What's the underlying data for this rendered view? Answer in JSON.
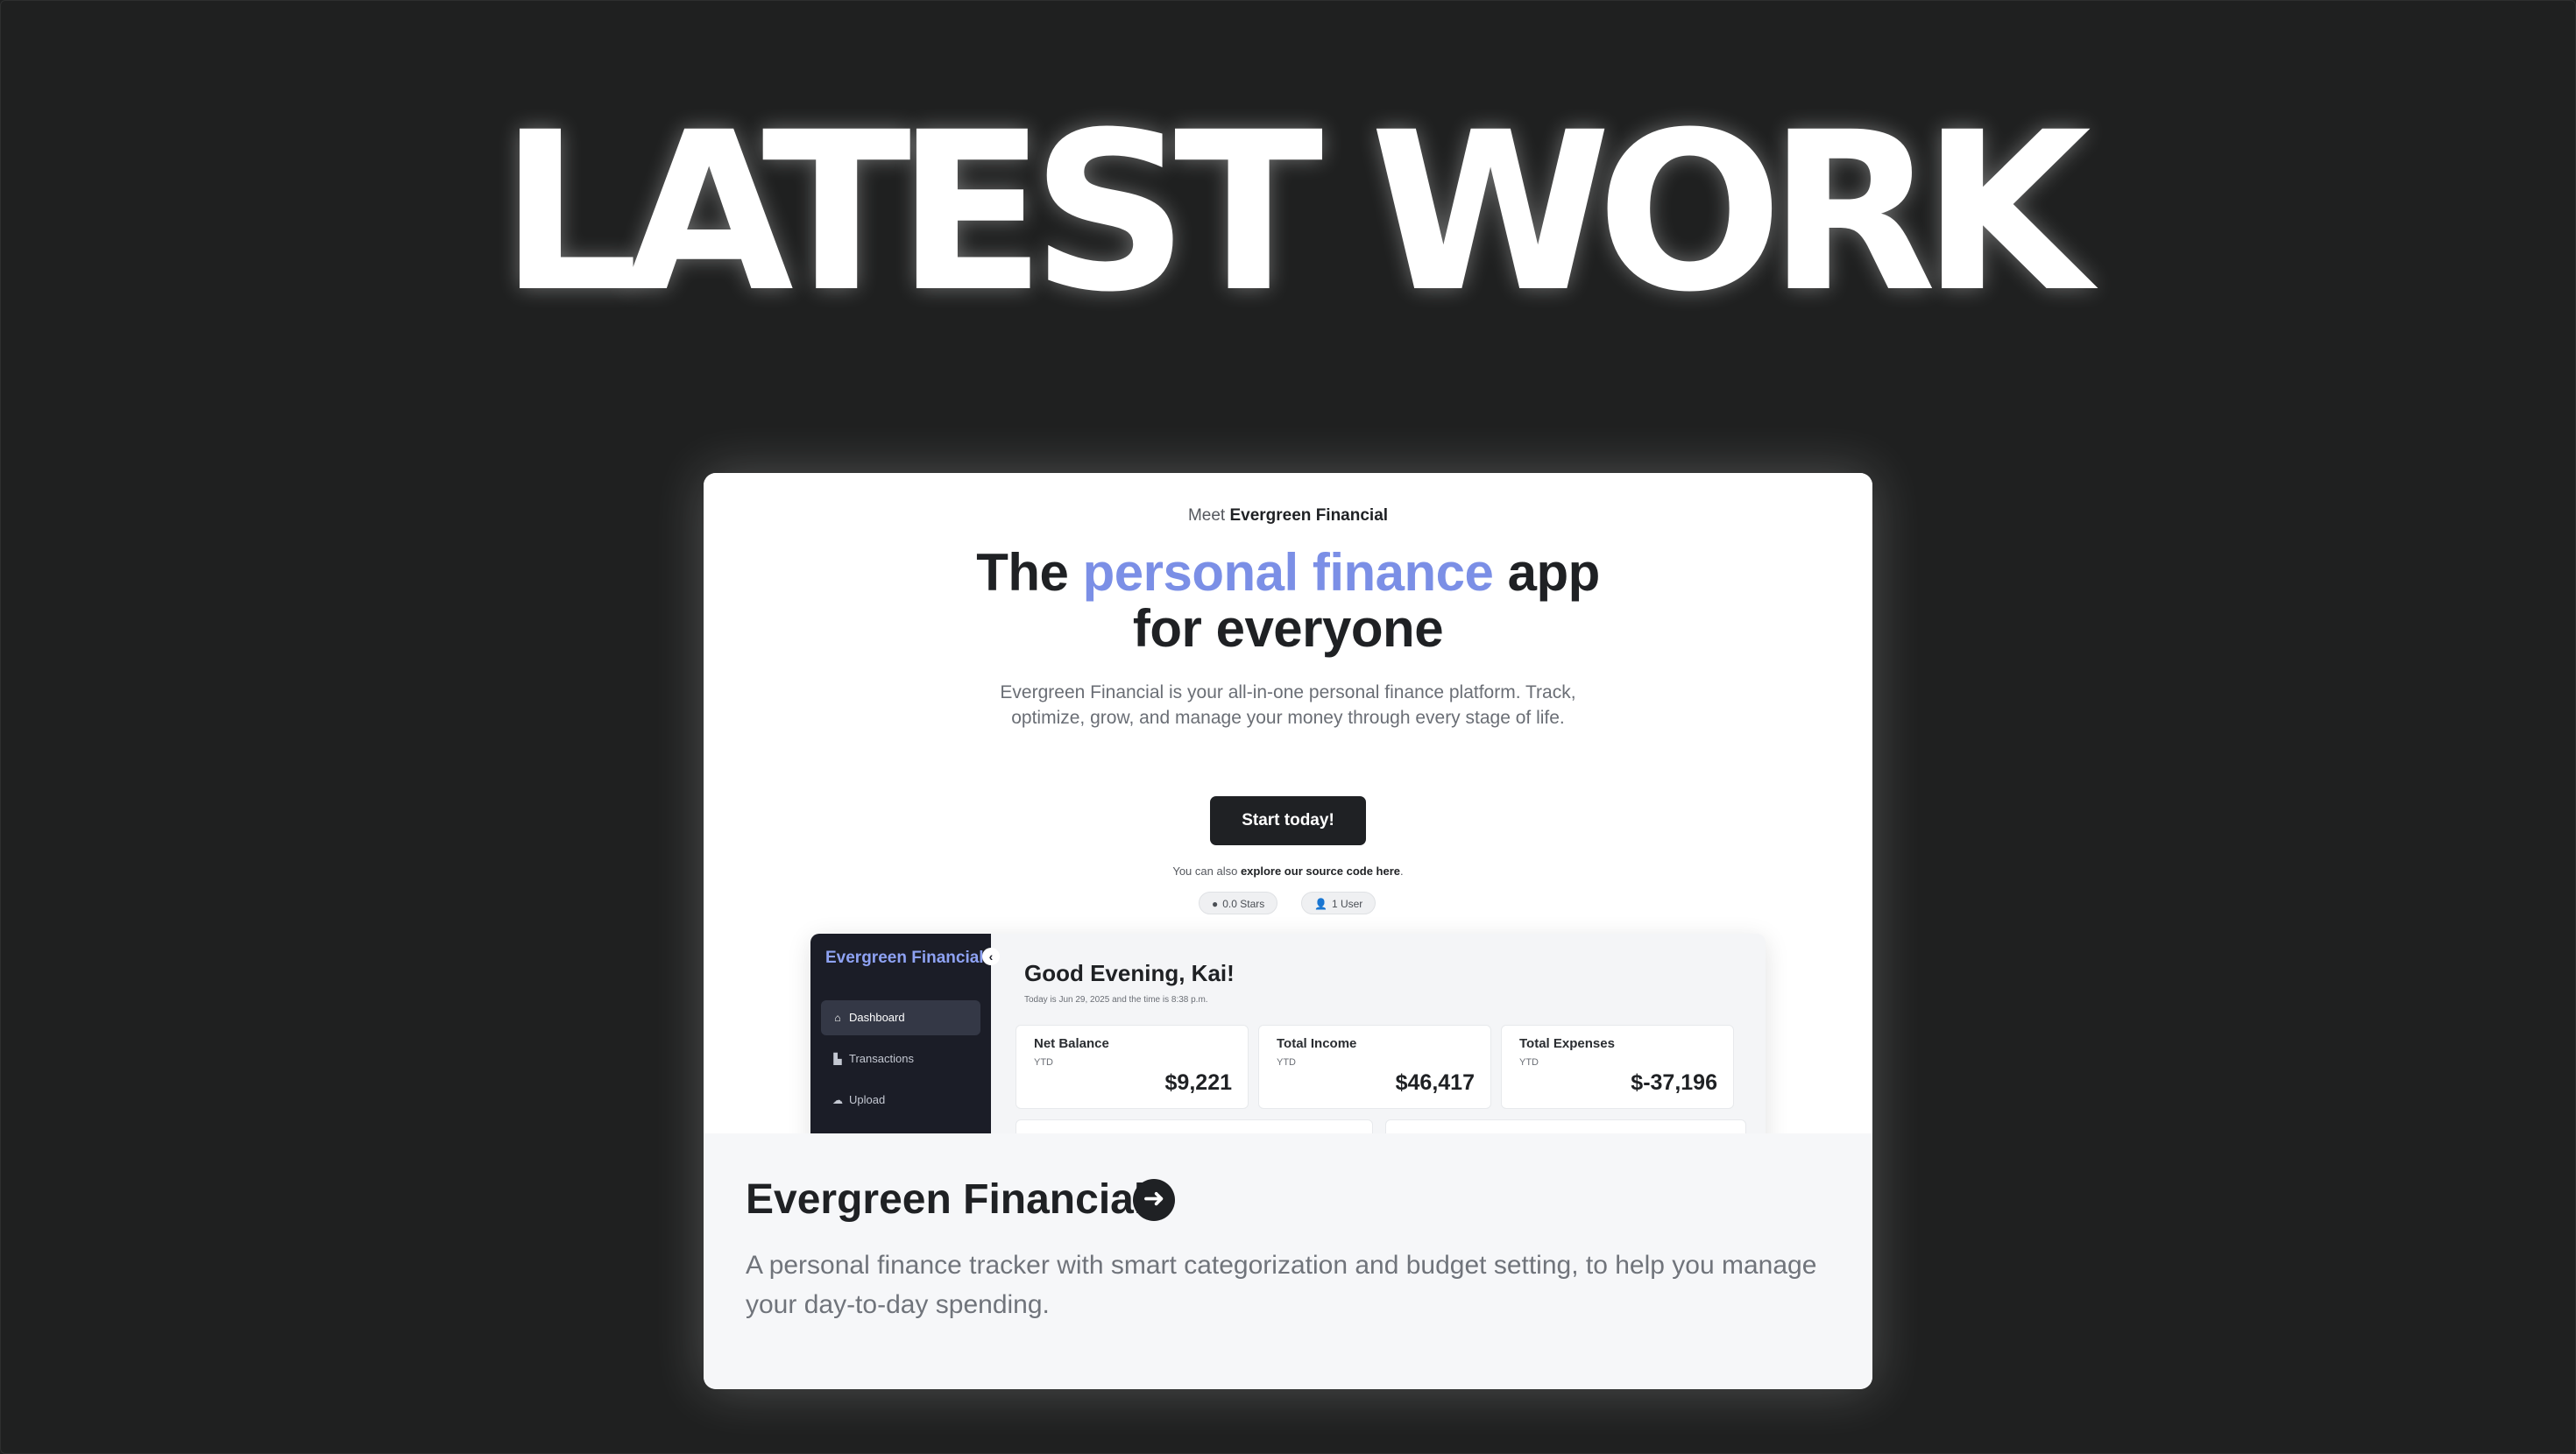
{
  "section": {
    "title": "LATEST WORK"
  },
  "preview": {
    "meet_prefix": "Meet",
    "meet_brand": "Evergreen Financial",
    "hero_title_start": "The",
    "hero_title_accent": "personal finance",
    "hero_title_mid": "app",
    "hero_title_end": "for everyone",
    "hero_description": "Evergreen Financial is your all-in-one personal finance platform. Track, optimize, grow, and manage your money through every stage of life.",
    "cta_label": "Start today!",
    "source_prefix": "You can also",
    "source_link": "explore our source code here",
    "source_suffix": ".",
    "stars_pill": "0.0 Stars",
    "users_pill": "1 User",
    "app": {
      "brand": "Evergreen Financial",
      "nav": [
        {
          "label": "Dashboard",
          "icon": "home-icon"
        },
        {
          "label": "Transactions",
          "icon": "chart-icon"
        },
        {
          "label": "Upload",
          "icon": "cloud-upload-icon"
        }
      ],
      "greeting": "Good Evening, Kai!",
      "greeting_sub": "Today is Jun 29, 2025 and the time is 8:38 p.m.",
      "stats": [
        {
          "label": "Net Balance",
          "period": "YTD",
          "value": "$9,221"
        },
        {
          "label": "Total Income",
          "period": "YTD",
          "value": "$46,417"
        },
        {
          "label": "Total Expenses",
          "period": "YTD",
          "value": "$-37,196"
        }
      ]
    }
  },
  "project": {
    "title": "Evergreen Financial",
    "arrow_icon": "arrow-right-icon",
    "description": "A personal finance tracker with smart categorization and budget setting, to help you manage your day-to-day spending."
  },
  "colors": {
    "background": "#1f2020",
    "accent": "#7b8fe6",
    "sidebar": "#1b1d27",
    "dark_text": "#1f2124"
  }
}
